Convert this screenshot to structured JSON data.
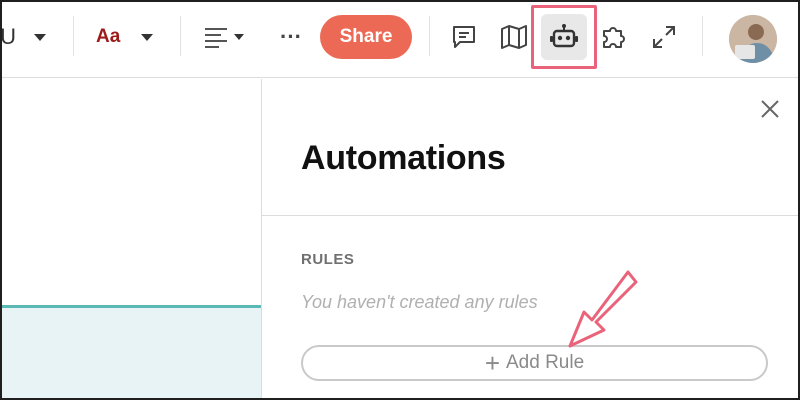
{
  "toolbar": {
    "underline_glyph": "U",
    "text_style_label": "Aa",
    "more_label": "···",
    "share_label": "Share",
    "icons": [
      "chevron-down-icon",
      "align-left-icon",
      "comment-icon",
      "map-icon",
      "robot-icon",
      "puzzle-icon",
      "expand-icon"
    ],
    "highlight_color": "#e9637a",
    "share_color": "#ec6a55"
  },
  "panel": {
    "title": "Automations",
    "section_label": "RULES",
    "empty_message": "You haven't created any rules",
    "add_rule_label": "Add Rule",
    "add_rule_icon": "+"
  },
  "annotation": {
    "arrow_color": "#e9637a"
  }
}
